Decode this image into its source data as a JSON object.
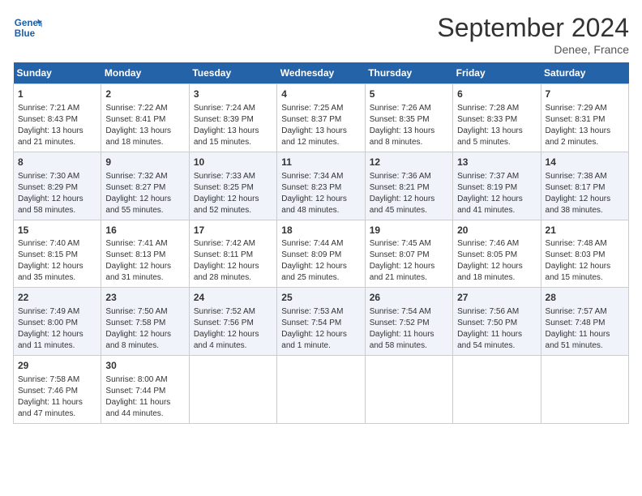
{
  "header": {
    "logo_line1": "General",
    "logo_line2": "Blue",
    "month_title": "September 2024",
    "location": "Denee, France"
  },
  "columns": [
    "Sunday",
    "Monday",
    "Tuesday",
    "Wednesday",
    "Thursday",
    "Friday",
    "Saturday"
  ],
  "weeks": [
    [
      {
        "day": "1",
        "info": "Sunrise: 7:21 AM\nSunset: 8:43 PM\nDaylight: 13 hours\nand 21 minutes."
      },
      {
        "day": "2",
        "info": "Sunrise: 7:22 AM\nSunset: 8:41 PM\nDaylight: 13 hours\nand 18 minutes."
      },
      {
        "day": "3",
        "info": "Sunrise: 7:24 AM\nSunset: 8:39 PM\nDaylight: 13 hours\nand 15 minutes."
      },
      {
        "day": "4",
        "info": "Sunrise: 7:25 AM\nSunset: 8:37 PM\nDaylight: 13 hours\nand 12 minutes."
      },
      {
        "day": "5",
        "info": "Sunrise: 7:26 AM\nSunset: 8:35 PM\nDaylight: 13 hours\nand 8 minutes."
      },
      {
        "day": "6",
        "info": "Sunrise: 7:28 AM\nSunset: 8:33 PM\nDaylight: 13 hours\nand 5 minutes."
      },
      {
        "day": "7",
        "info": "Sunrise: 7:29 AM\nSunset: 8:31 PM\nDaylight: 13 hours\nand 2 minutes."
      }
    ],
    [
      {
        "day": "8",
        "info": "Sunrise: 7:30 AM\nSunset: 8:29 PM\nDaylight: 12 hours\nand 58 minutes."
      },
      {
        "day": "9",
        "info": "Sunrise: 7:32 AM\nSunset: 8:27 PM\nDaylight: 12 hours\nand 55 minutes."
      },
      {
        "day": "10",
        "info": "Sunrise: 7:33 AM\nSunset: 8:25 PM\nDaylight: 12 hours\nand 52 minutes."
      },
      {
        "day": "11",
        "info": "Sunrise: 7:34 AM\nSunset: 8:23 PM\nDaylight: 12 hours\nand 48 minutes."
      },
      {
        "day": "12",
        "info": "Sunrise: 7:36 AM\nSunset: 8:21 PM\nDaylight: 12 hours\nand 45 minutes."
      },
      {
        "day": "13",
        "info": "Sunrise: 7:37 AM\nSunset: 8:19 PM\nDaylight: 12 hours\nand 41 minutes."
      },
      {
        "day": "14",
        "info": "Sunrise: 7:38 AM\nSunset: 8:17 PM\nDaylight: 12 hours\nand 38 minutes."
      }
    ],
    [
      {
        "day": "15",
        "info": "Sunrise: 7:40 AM\nSunset: 8:15 PM\nDaylight: 12 hours\nand 35 minutes."
      },
      {
        "day": "16",
        "info": "Sunrise: 7:41 AM\nSunset: 8:13 PM\nDaylight: 12 hours\nand 31 minutes."
      },
      {
        "day": "17",
        "info": "Sunrise: 7:42 AM\nSunset: 8:11 PM\nDaylight: 12 hours\nand 28 minutes."
      },
      {
        "day": "18",
        "info": "Sunrise: 7:44 AM\nSunset: 8:09 PM\nDaylight: 12 hours\nand 25 minutes."
      },
      {
        "day": "19",
        "info": "Sunrise: 7:45 AM\nSunset: 8:07 PM\nDaylight: 12 hours\nand 21 minutes."
      },
      {
        "day": "20",
        "info": "Sunrise: 7:46 AM\nSunset: 8:05 PM\nDaylight: 12 hours\nand 18 minutes."
      },
      {
        "day": "21",
        "info": "Sunrise: 7:48 AM\nSunset: 8:03 PM\nDaylight: 12 hours\nand 15 minutes."
      }
    ],
    [
      {
        "day": "22",
        "info": "Sunrise: 7:49 AM\nSunset: 8:00 PM\nDaylight: 12 hours\nand 11 minutes."
      },
      {
        "day": "23",
        "info": "Sunrise: 7:50 AM\nSunset: 7:58 PM\nDaylight: 12 hours\nand 8 minutes."
      },
      {
        "day": "24",
        "info": "Sunrise: 7:52 AM\nSunset: 7:56 PM\nDaylight: 12 hours\nand 4 minutes."
      },
      {
        "day": "25",
        "info": "Sunrise: 7:53 AM\nSunset: 7:54 PM\nDaylight: 12 hours\nand 1 minute."
      },
      {
        "day": "26",
        "info": "Sunrise: 7:54 AM\nSunset: 7:52 PM\nDaylight: 11 hours\nand 58 minutes."
      },
      {
        "day": "27",
        "info": "Sunrise: 7:56 AM\nSunset: 7:50 PM\nDaylight: 11 hours\nand 54 minutes."
      },
      {
        "day": "28",
        "info": "Sunrise: 7:57 AM\nSunset: 7:48 PM\nDaylight: 11 hours\nand 51 minutes."
      }
    ],
    [
      {
        "day": "29",
        "info": "Sunrise: 7:58 AM\nSunset: 7:46 PM\nDaylight: 11 hours\nand 47 minutes."
      },
      {
        "day": "30",
        "info": "Sunrise: 8:00 AM\nSunset: 7:44 PM\nDaylight: 11 hours\nand 44 minutes."
      },
      {
        "day": "",
        "info": ""
      },
      {
        "day": "",
        "info": ""
      },
      {
        "day": "",
        "info": ""
      },
      {
        "day": "",
        "info": ""
      },
      {
        "day": "",
        "info": ""
      }
    ]
  ]
}
